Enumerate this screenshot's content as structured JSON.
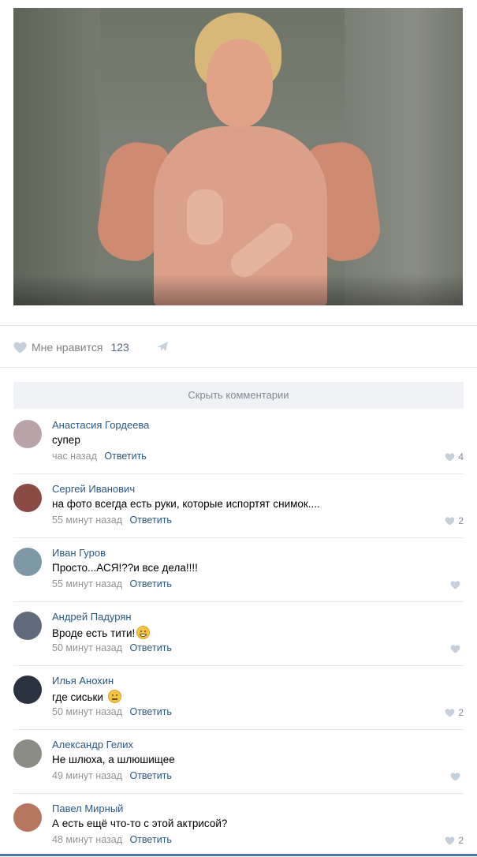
{
  "post": {
    "likes_label": "Мне нравится",
    "likes_count": "123",
    "hide_comments_label": "Скрыть комментарии"
  },
  "comments": [
    {
      "author": "Анастасия Гордеева",
      "text": "супер",
      "emoji": "",
      "time": "час назад",
      "reply": "Ответить",
      "likes": "4",
      "avatar_color": "#b9a3a8"
    },
    {
      "author": "Сергей Иванович",
      "text": "на фото всегда есть руки, которые испортят снимок....",
      "emoji": "",
      "time": "55 минут назад",
      "reply": "Ответить",
      "likes": "2",
      "avatar_color": "#8a4b44"
    },
    {
      "author": "Иван Гуров",
      "text": "Просто...АСЯ!??и все дела!!!!",
      "emoji": "",
      "time": "55 минут назад",
      "reply": "Ответить",
      "likes": "",
      "avatar_color": "#7d99a8"
    },
    {
      "author": "Андрей Падурян",
      "text": "Вроде есть тити!",
      "emoji": "grin",
      "time": "50 минут назад",
      "reply": "Ответить",
      "likes": "",
      "avatar_color": "#5f6b7a"
    },
    {
      "author": "Илья Анохин",
      "text": "где сиськи ",
      "emoji": "neutral",
      "time": "50 минут назад",
      "reply": "Ответить",
      "likes": "2",
      "avatar_color": "#2c3340"
    },
    {
      "author": "Александр Гелих",
      "text": "Не шлюха, а шлюшищее",
      "emoji": "",
      "time": "49 минут назад",
      "reply": "Ответить",
      "likes": "",
      "avatar_color": "#8c8c86"
    },
    {
      "author": "Павел Мирный",
      "text": "А есть ещё что-то с этой актрисой?",
      "emoji": "",
      "time": "48 минут назад",
      "reply": "Ответить",
      "likes": "2",
      "avatar_color": "#b7765f"
    }
  ],
  "colors": {
    "link": "#2a5885",
    "muted": "#939393",
    "accent": "#4a76a8"
  }
}
